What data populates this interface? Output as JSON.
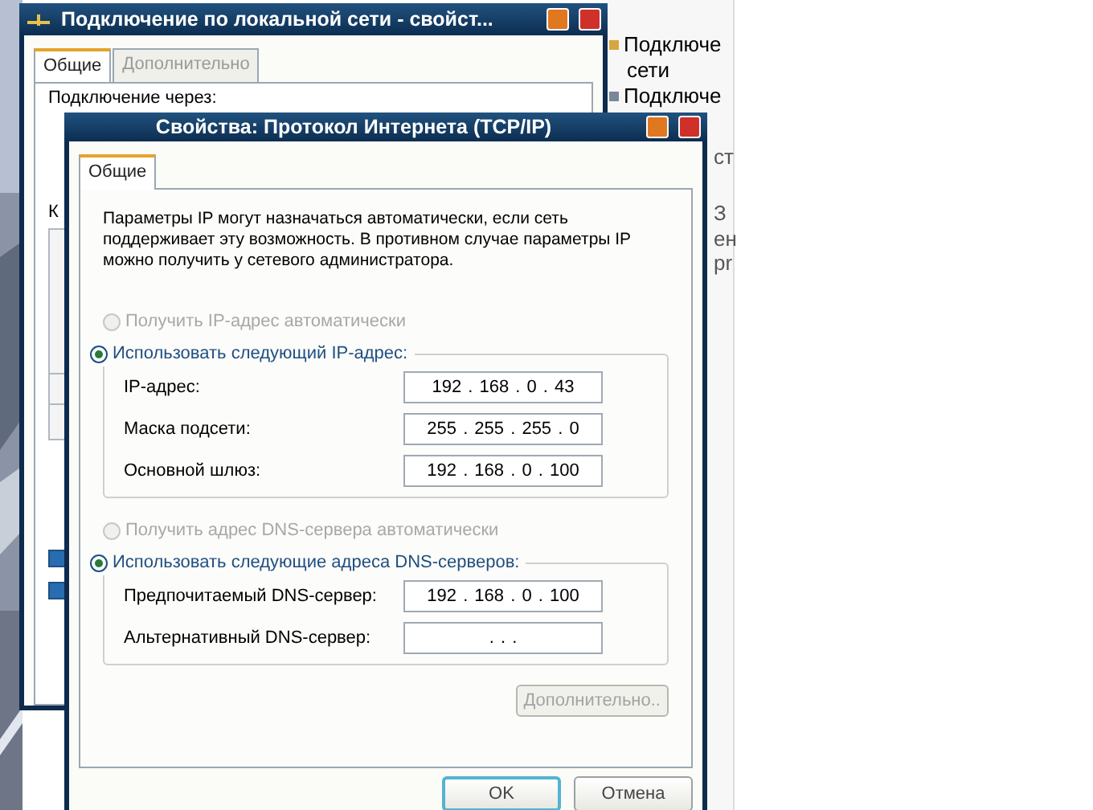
{
  "side_window": {
    "items": [
      "Подключе",
      "сети",
      "Подключе"
    ],
    "fragments": [
      "ст",
      "З",
      "ен",
      "pr"
    ]
  },
  "background_window": {
    "title": "Подключение по локальной сети - свойст...",
    "tabs": [
      {
        "label": "Общие",
        "selected": true
      },
      {
        "label": "Дополнительно",
        "selected": false
      }
    ],
    "via_label": "Подключение через:",
    "fragment": "К",
    "checkboxes": [
      {
        "checked": true
      },
      {
        "checked": true
      }
    ]
  },
  "dialog": {
    "title": "Свойства: Протокол Интернета (TCP/IP)",
    "tabs": [
      {
        "label": "Общие",
        "selected": true
      }
    ],
    "description": "Параметры IP могут назначаться автоматически, если сеть поддерживает эту возможность. В противном случае параметры IP можно получить у сетевого администратора.",
    "sections": [
      {
        "auto_option": {
          "label": "Получить IP-адрес автоматически",
          "selected": false,
          "disabled": true
        },
        "manual_option": {
          "label": "Использовать следующий IP-адрес:",
          "selected": true,
          "disabled": false
        },
        "fields": [
          {
            "label": "IP-адрес:",
            "value": "192 . 168 . 0 . 43"
          },
          {
            "label": "Маска подсети:",
            "value": "255 . 255 . 255 . 0"
          },
          {
            "label": "Основной шлюз:",
            "value": "192 . 168 . 0 . 100"
          }
        ]
      },
      {
        "auto_option": {
          "label": "Получить адрес DNS-сервера автоматически",
          "selected": false,
          "disabled": true
        },
        "manual_option": {
          "label": "Использовать следующие адреса DNS-серверов:",
          "selected": true,
          "disabled": false
        },
        "fields": [
          {
            "label": "Предпочитаемый DNS-сервер:",
            "value": "192 . 168 . 0 . 100"
          },
          {
            "label": "Альтернативный DNS-сервер:",
            "value": ". . ."
          }
        ]
      }
    ],
    "advanced_button": {
      "label": "Дополнительно..",
      "disabled": true
    },
    "buttons": [
      {
        "label": "OK",
        "default": true
      },
      {
        "label": "Отмена",
        "default": false
      }
    ]
  }
}
